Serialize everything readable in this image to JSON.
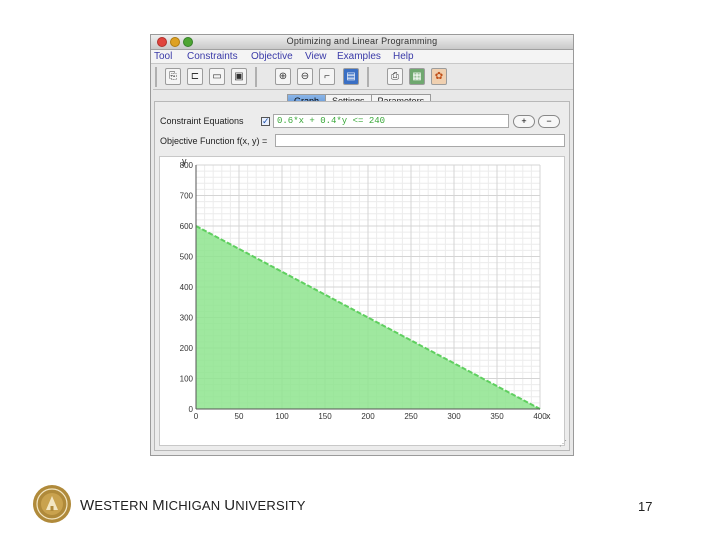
{
  "window": {
    "title": "Optimizing and Linear Programming"
  },
  "menu": [
    "Tool",
    "Constraints",
    "Objective",
    "View",
    "Examples",
    "Help"
  ],
  "tabs": [
    {
      "label": "Graph",
      "active": true
    },
    {
      "label": "Settings",
      "active": false
    },
    {
      "label": "Parameters",
      "active": false
    }
  ],
  "constraints": {
    "label": "Constraint Equations",
    "checked": true,
    "value": "0.6*x + 0.4*y <= 240",
    "add_label": "+",
    "remove_label": "−"
  },
  "objective": {
    "label": "Objective Function f(x, y) =",
    "value": ""
  },
  "chart_data": {
    "type": "area",
    "xlabel": "x",
    "ylabel": "y",
    "xlim": [
      0,
      400
    ],
    "ylim": [
      0,
      800
    ],
    "x_ticks": [
      0,
      50,
      100,
      150,
      200,
      250,
      300,
      350,
      400
    ],
    "y_ticks": [
      0,
      100,
      200,
      300,
      400,
      500,
      600,
      700,
      800
    ],
    "grid": true,
    "region": {
      "constraint": "0.6*x + 0.4*y <= 240",
      "vertices": [
        [
          0,
          0
        ],
        [
          0,
          600
        ],
        [
          400,
          0
        ]
      ]
    },
    "line": {
      "x": [
        0,
        400
      ],
      "y": [
        600,
        0
      ]
    },
    "colors": {
      "fill": "#8ee48e",
      "line": "#5fcf5f",
      "grid": "#d4d4d4"
    }
  },
  "footer": {
    "org_w": "W",
    "org_estern": "ESTERN ",
    "org_m": "M",
    "org_ichigan": "ICHIGAN ",
    "org_u": "U",
    "org_niversity": "NIVERSITY",
    "page_number": "17"
  }
}
